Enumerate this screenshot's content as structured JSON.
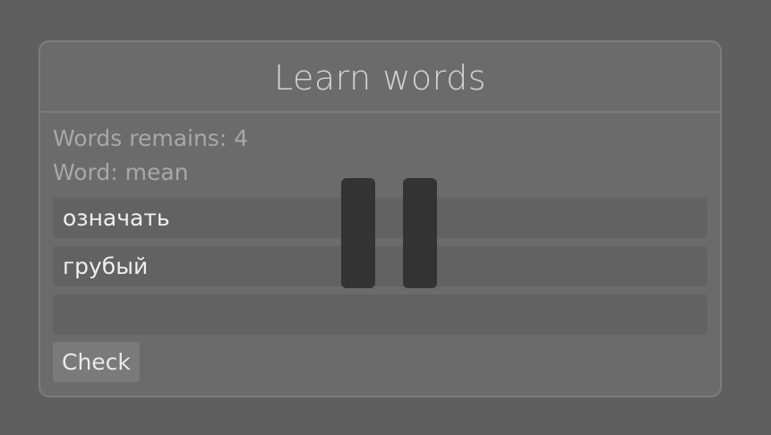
{
  "panel": {
    "title": "Learn words",
    "words_remains": "Words remains: 4",
    "word": "Word: mean",
    "options": [
      {
        "text": "означать"
      },
      {
        "text": "грубый"
      }
    ],
    "answer_input": {
      "value": "",
      "placeholder": ""
    },
    "check_label": "Check"
  },
  "overlay": {
    "icon": "pause-icon"
  },
  "colors": {
    "background": "#5f5f5f",
    "panel": "#6b6b6b",
    "field": "#626262",
    "button": "#7a7a7a",
    "pause_bar": "#333333"
  }
}
